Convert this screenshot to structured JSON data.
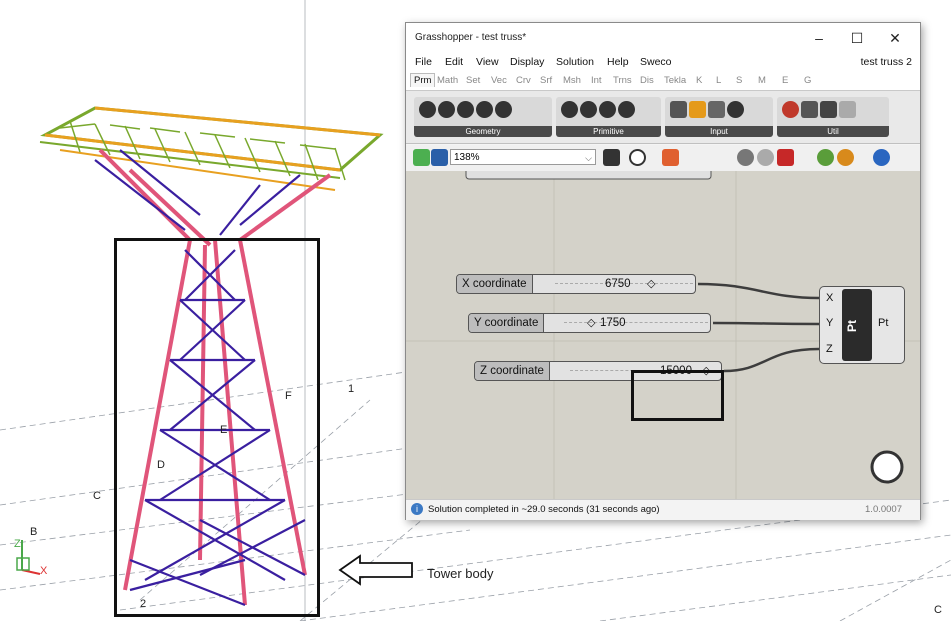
{
  "window": {
    "title": "Grasshopper - test truss*",
    "controls": [
      "–",
      "☐",
      "✕"
    ]
  },
  "menu": {
    "items": [
      "File",
      "Edit",
      "View",
      "Display",
      "Solution",
      "Help",
      "Sweco"
    ],
    "document_name": "test truss 2"
  },
  "tabs": [
    "Prm",
    "Math",
    "Set",
    "Vec",
    "Crv",
    "Srf",
    "Msh",
    "Int",
    "Trns",
    "Dis",
    "Tekla",
    "K",
    "L",
    "S",
    "M",
    "E",
    "G"
  ],
  "active_tab": "Prm",
  "ribbon": {
    "groups": [
      {
        "label": "Geometry",
        "icon_count": 5
      },
      {
        "label": "Primitive",
        "icon_count": 4
      },
      {
        "label": "Input",
        "icon_count": 4
      },
      {
        "label": "Util",
        "icon_count": 4
      }
    ]
  },
  "toolbar": {
    "zoom": "138%"
  },
  "canvas": {
    "sliders": [
      {
        "name": "X coordinate",
        "value": "6750"
      },
      {
        "name": "Y coordinate",
        "value": "1750"
      },
      {
        "name": "Z coordinate",
        "value": "15000"
      }
    ],
    "component": {
      "name": "Pt",
      "inputs": [
        "X",
        "Y",
        "Z"
      ],
      "output": "Pt"
    }
  },
  "status": {
    "text": "Solution completed in ~29.0 seconds (31 seconds ago)",
    "version": "1.0.0007"
  },
  "scene": {
    "grid_labels": [
      "F",
      "E",
      "D",
      "C",
      "B",
      "1",
      "2",
      "C"
    ],
    "axis_labels": [
      "Z",
      "X"
    ],
    "annotation": "Tower body",
    "colors": {
      "chord": "#e0557a",
      "bracing": "#3a1fa0",
      "top_truss": "#79a82d",
      "top_truss_flange": "#e8a020"
    }
  }
}
